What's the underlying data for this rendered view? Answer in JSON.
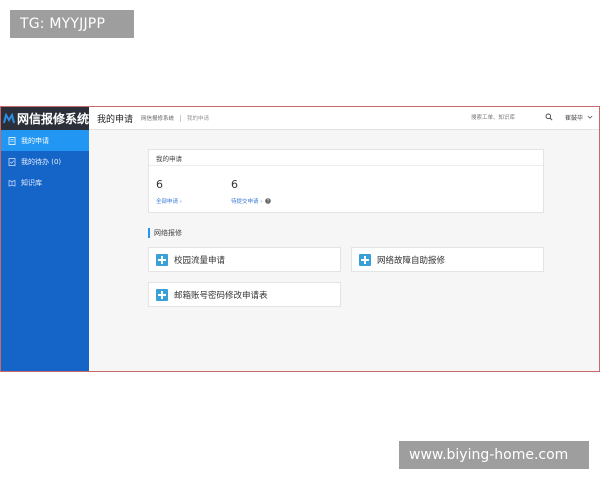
{
  "watermarks": {
    "top": "TG: MYYJJPP",
    "bottom": "www.biying-home.com"
  },
  "app": {
    "logo_text": "网信报修系统",
    "sidebar": {
      "items": [
        {
          "label": "我的申请",
          "icon": "document-icon"
        },
        {
          "label": "我的待办 (0)",
          "icon": "todo-icon"
        },
        {
          "label": "知识库",
          "icon": "book-icon"
        }
      ]
    },
    "header": {
      "title": "我的申请",
      "breadcrumb_root": "网信报修系统",
      "breadcrumb_current": "我的申请",
      "search_placeholder": "搜索工单、知识库",
      "user_name": "崔鼓毕"
    },
    "summary_card": {
      "title": "我的申请",
      "stats": [
        {
          "value": "6",
          "link": "全部申请 ›"
        },
        {
          "value": "6",
          "link": "待提交申请 ›"
        }
      ]
    },
    "section_title": "网络报修",
    "services": [
      {
        "label": "校园流量申请"
      },
      {
        "label": "网络故障自助报修"
      },
      {
        "label": "邮箱账号密码修改申请表"
      }
    ],
    "colors": {
      "sidebar_bg": "#1565c8",
      "sidebar_active": "#2196f3",
      "logo_bg": "#2a2f3a",
      "accent_plus": "#3aa0d8",
      "link": "#3a7bd5"
    }
  }
}
